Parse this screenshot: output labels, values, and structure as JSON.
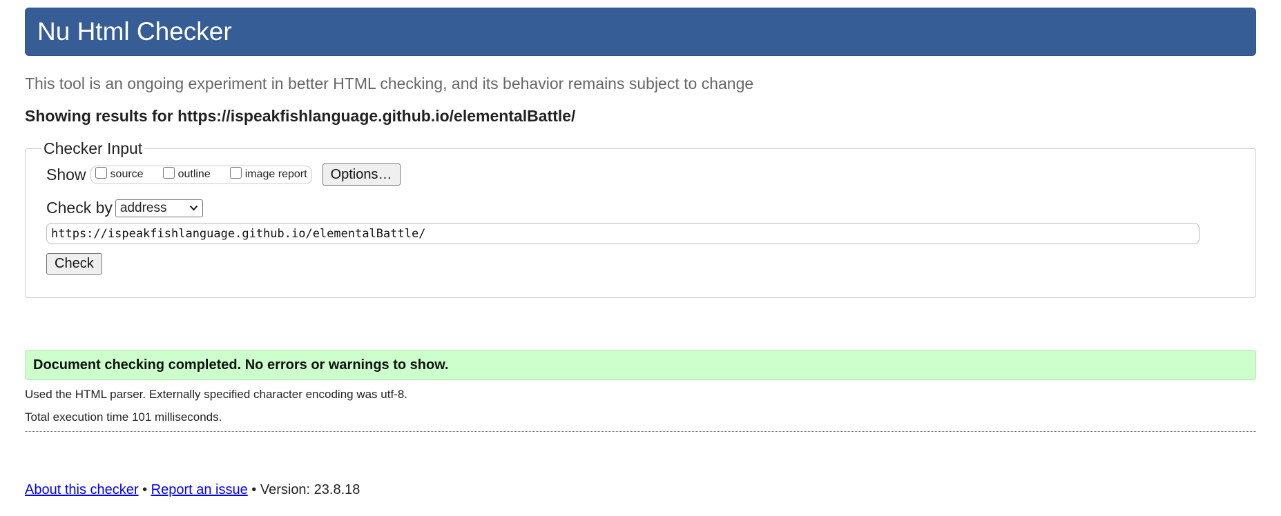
{
  "header": {
    "title": "Nu Html Checker"
  },
  "tagline": "This tool is an ongoing experiment in better HTML checking, and its behavior remains subject to change",
  "showing_results": "Showing results for https://ispeakfishlanguage.github.io/elementalBattle/",
  "checker_input": {
    "legend": "Checker Input",
    "show_label": "Show",
    "show_options": [
      {
        "label": "source",
        "checked": false
      },
      {
        "label": "outline",
        "checked": false
      },
      {
        "label": "image report",
        "checked": false
      }
    ],
    "options_button": "Options…",
    "check_by_label": "Check by",
    "check_by_value": "address",
    "url_value": "https://ispeakfishlanguage.github.io/elementalBattle/",
    "check_button": "Check"
  },
  "result": {
    "message": "Document checking completed. No errors or warnings to show.",
    "parser_info": "Used the HTML parser. Externally specified character encoding was utf-8.",
    "execution_time": "Total execution time 101 milliseconds."
  },
  "footer": {
    "about_link": "About this checker",
    "separator1": " • ",
    "report_link": "Report an issue",
    "version_text": " • Version: 23.8.18"
  },
  "colors": {
    "header_bg": "#365d95",
    "success_bg": "#ccffcc",
    "link": "#0000ee"
  }
}
